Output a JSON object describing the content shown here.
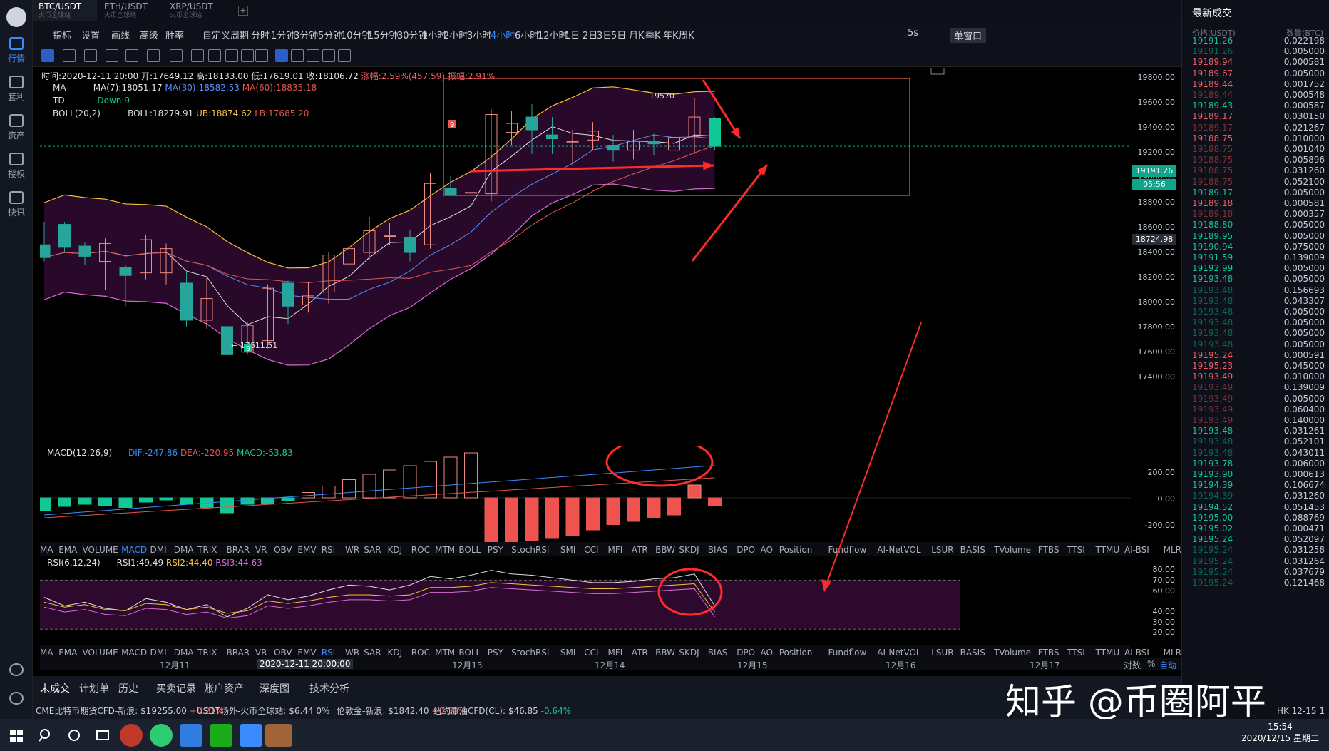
{
  "pair_tabs": [
    {
      "label": "BTC/USDT",
      "sub": "火币全球站"
    },
    {
      "label": "ETH/USDT",
      "sub": "火币全球站"
    },
    {
      "label": "XRP/USDT",
      "sub": "火币全球站"
    }
  ],
  "sidebar": [
    {
      "label": "行情"
    },
    {
      "label": "套利"
    },
    {
      "label": "资产"
    },
    {
      "label": "授权"
    },
    {
      "label": "快讯"
    }
  ],
  "toolbar": {
    "items": [
      "指标",
      "设置",
      "画线",
      "高级",
      "胜率",
      "自定义周期",
      "分时",
      "1分钟",
      "3分钟",
      "5分钟",
      "10分钟",
      "15分钟",
      "30分钟",
      "1小时",
      "2小时",
      "3小时",
      "4小时",
      "6小时",
      "12小时",
      "1日",
      "2日",
      "3日",
      "5日",
      "月K",
      "季K",
      "年K",
      "周K"
    ],
    "active": "4小时",
    "refresh": "5s",
    "window_label": "单窗口"
  },
  "info_line": {
    "time": "时间:2020-12-11 20:00",
    "open": "开:17649.12",
    "high": "高:18133.00",
    "low": "低:17619.01",
    "close": "收:18106.72",
    "change": "涨幅:2.59%(457.59)",
    "amp": "振幅:2.91%"
  },
  "ma_line": {
    "name": "MA",
    "ma7": "MA(7):18051.17",
    "ma30": "MA(30):18582.53",
    "ma60": "MA(60):18835.18"
  },
  "td_line": {
    "name": "TD",
    "down": "Down:9"
  },
  "boll_line": {
    "name": "BOLL(20,2)",
    "boll": "BOLL:18279.91",
    "ub": "UB:18874.62",
    "lb": "LB:17685.20"
  },
  "annotations": {
    "high": "19570",
    "low": "17611.51",
    "td_sell": "9",
    "td_buy": "9"
  },
  "price_axis": [
    "19800.00",
    "19600.00",
    "19400.00",
    "19200.00",
    "19000.00",
    "18800.00",
    "18600.00",
    "18400.00",
    "18200.00",
    "18000.00",
    "17800.00",
    "17600.00",
    "17400.00"
  ],
  "last_price": "19191.26",
  "countdown": "05:56",
  "crosshair_price": "18724.98",
  "macd": {
    "title": "MACD(12,26,9)",
    "dif": "DIF:-247.86",
    "dea": "DEA:-220.95",
    "macd": "MACD:-53.83",
    "axis": [
      "200.00",
      "0.00",
      "-200.00"
    ]
  },
  "rsi": {
    "title": "RSI(6,12,24)",
    "rsi1": "RSI1:49.49",
    "rsi2": "RSI2:44.40",
    "rsi3": "RSI3:44.63",
    "axis": [
      "80.00",
      "70.00",
      "60.00",
      "40.00",
      "30.00",
      "20.00"
    ]
  },
  "indicators": [
    "MA",
    "EMA",
    "VOLUME",
    "MACD",
    "DMI",
    "DMA",
    "TRIX",
    "BRAR",
    "VR",
    "OBV",
    "EMV",
    "RSI",
    "WR",
    "SAR",
    "KDJ",
    "ROC",
    "MTM",
    "BOLL",
    "PSY",
    "StochRSI",
    "SMI",
    "CCI",
    "MFI",
    "ATR",
    "BBW",
    "SKDJ",
    "BIAS",
    "DPO",
    "AO",
    "Position",
    "Fundflow",
    "AI-NetVOL",
    "LSUR",
    "BASIS",
    "TVolume",
    "FTBS",
    "TTSI",
    "TTMU",
    "AI-BSI",
    "MLR"
  ],
  "xaxis": {
    "labels": [
      "12月11",
      "2020-12-11 20:00:00",
      "12月13",
      "12月14",
      "12月15",
      "12月16",
      "12月17"
    ],
    "right": [
      "对数",
      "%",
      "自动"
    ]
  },
  "bottom_tabs": [
    "未成交",
    "计划单",
    "历史",
    "买卖记录",
    "账户资产",
    "深度图",
    "技术分析"
  ],
  "ticker": [
    {
      "name": "CME比特币期货CFD-新浪:",
      "price": "$19255.00",
      "chg": "+0.21%"
    },
    {
      "name": "USDT场外-火币全球站:",
      "price": "$6.44",
      "chg": "0%"
    },
    {
      "name": "伦敦金-新浪:",
      "price": "$1842.40",
      "chg": "+0.51%"
    },
    {
      "name": "纽约原油CFD(CL):",
      "price": "$46.85",
      "chg": "-0.64%"
    }
  ],
  "trades": {
    "title": "最新成交",
    "col_price": "价格(USDT)",
    "col_qty": "数量(BTC)",
    "rows": [
      [
        "19191.26",
        "0.022198",
        "g"
      ],
      [
        "19191.26",
        "0.005000",
        "gd"
      ],
      [
        "19189.94",
        "0.000581",
        "r"
      ],
      [
        "19189.67",
        "0.005000",
        "r"
      ],
      [
        "19189.44",
        "0.001752",
        "r"
      ],
      [
        "19189.44",
        "0.000548",
        "rd"
      ],
      [
        "19189.43",
        "0.000587",
        "g"
      ],
      [
        "19189.17",
        "0.030150",
        "r"
      ],
      [
        "19189.17",
        "0.021267",
        "rd"
      ],
      [
        "19188.75",
        "0.010000",
        "r"
      ],
      [
        "19188.75",
        "0.001040",
        "rd"
      ],
      [
        "19188.75",
        "0.005896",
        "rd"
      ],
      [
        "19188.75",
        "0.031260",
        "rd"
      ],
      [
        "19188.75",
        "0.052100",
        "rd"
      ],
      [
        "19189.17",
        "0.005000",
        "g"
      ],
      [
        "19189.18",
        "0.000581",
        "r"
      ],
      [
        "19189.18",
        "0.000357",
        "rd"
      ],
      [
        "19188.80",
        "0.005000",
        "g"
      ],
      [
        "19189.95",
        "0.005000",
        "g"
      ],
      [
        "19190.94",
        "0.075000",
        "g"
      ],
      [
        "19191.59",
        "0.139009",
        "g"
      ],
      [
        "19192.99",
        "0.005000",
        "g"
      ],
      [
        "19193.48",
        "0.005000",
        "g"
      ],
      [
        "19193.48",
        "0.156693",
        "gd"
      ],
      [
        "19193.48",
        "0.043307",
        "gd"
      ],
      [
        "19193.48",
        "0.005000",
        "gd"
      ],
      [
        "19193.48",
        "0.005000",
        "gd"
      ],
      [
        "19193.48",
        "0.005000",
        "gd"
      ],
      [
        "19193.48",
        "0.005000",
        "gd"
      ],
      [
        "19195.24",
        "0.000591",
        "r"
      ],
      [
        "19195.23",
        "0.045000",
        "r"
      ],
      [
        "19193.49",
        "0.010000",
        "r"
      ],
      [
        "19193.49",
        "0.139009",
        "rd"
      ],
      [
        "19193.49",
        "0.005000",
        "rd"
      ],
      [
        "19193.49",
        "0.060400",
        "rd"
      ],
      [
        "19193.49",
        "0.140000",
        "rd"
      ],
      [
        "19193.48",
        "0.031261",
        "g"
      ],
      [
        "19193.48",
        "0.052101",
        "gd"
      ],
      [
        "19193.48",
        "0.043011",
        "gd"
      ],
      [
        "19193.78",
        "0.006000",
        "g"
      ],
      [
        "19193.90",
        "0.000613",
        "g"
      ],
      [
        "19194.39",
        "0.106674",
        "g"
      ],
      [
        "19194.39",
        "0.031260",
        "gd"
      ],
      [
        "19194.52",
        "0.051453",
        "g"
      ],
      [
        "19195.00",
        "0.088769",
        "g"
      ],
      [
        "19195.02",
        "0.000471",
        "g"
      ],
      [
        "19195.24",
        "0.052097",
        "g"
      ],
      [
        "19195.24",
        "0.031258",
        "gd"
      ],
      [
        "19195.24",
        "0.031264",
        "gd"
      ],
      [
        "19195.24",
        "0.037679",
        "gd"
      ],
      [
        "19195.24",
        "0.121468",
        "gd"
      ]
    ]
  },
  "right_status": "HK 12-15 1",
  "taskbar": {
    "time": "15:54",
    "date": "2020/12/15 星期二"
  },
  "watermark": "知乎 @币圈阿平",
  "chart_data": {
    "type": "candlestick",
    "interval": "4小时",
    "x_labels": [
      "12月11",
      "12月13",
      "12月14",
      "12月15",
      "12月16",
      "12月17"
    ],
    "ylim": [
      17400,
      19800
    ],
    "candles": [
      [
        18420,
        18320,
        18600,
        18290
      ],
      [
        18580,
        18400,
        18600,
        18360
      ],
      [
        18410,
        18330,
        18440,
        18260
      ],
      [
        18290,
        18430,
        18470,
        18070
      ],
      [
        18240,
        18180,
        18260,
        17940
      ],
      [
        18200,
        18460,
        18500,
        18150
      ],
      [
        18200,
        18390,
        18430,
        18110
      ],
      [
        18120,
        17830,
        18210,
        17780
      ],
      [
        17830,
        18000,
        18160,
        17760
      ],
      [
        17780,
        17560,
        17810,
        17500
      ],
      [
        17580,
        17790,
        17820,
        17560
      ],
      [
        17670,
        18080,
        18110,
        17610
      ],
      [
        18120,
        17940,
        18140,
        17800
      ],
      [
        17950,
        18020,
        18130,
        17890
      ],
      [
        18050,
        18340,
        18360,
        17960
      ],
      [
        18270,
        18390,
        18440,
        18210
      ],
      [
        18360,
        18530,
        18640,
        18300
      ],
      [
        18490,
        18490,
        18590,
        18420
      ],
      [
        18480,
        18360,
        18540,
        18290
      ],
      [
        18420,
        18900,
        18980,
        18390
      ],
      [
        18860,
        18810,
        18960,
        18800
      ],
      [
        18830,
        18830,
        18870,
        18790
      ],
      [
        18820,
        19440,
        19480,
        18760
      ],
      [
        19300,
        19370,
        19470,
        19200
      ],
      [
        19420,
        19320,
        19520,
        19130
      ],
      [
        19280,
        19250,
        19420,
        19130
      ],
      [
        19230,
        19230,
        19320,
        19050
      ],
      [
        19240,
        19310,
        19380,
        19160
      ],
      [
        19200,
        19160,
        19280,
        19070
      ],
      [
        19160,
        19230,
        19320,
        19090
      ],
      [
        19230,
        19210,
        19290,
        19120
      ],
      [
        19160,
        19260,
        19350,
        19090
      ],
      [
        19270,
        19420,
        19570,
        19130
      ],
      [
        19410,
        19191,
        19420,
        19160
      ]
    ],
    "macd_hist": [
      -60,
      -40,
      -30,
      -35,
      -45,
      -20,
      -10,
      -30,
      -45,
      -70,
      -30,
      -25,
      -15,
      25,
      55,
      85,
      110,
      130,
      150,
      170,
      190,
      210,
      -235,
      -215,
      -200,
      -190,
      -175,
      -150,
      -125,
      -110,
      -95,
      -80,
      60,
      -35
    ],
    "rsi1": [
      56,
      49,
      52,
      47,
      45,
      55,
      52,
      46,
      50,
      40,
      47,
      58,
      54,
      57,
      62,
      66,
      65,
      62,
      66,
      73,
      71,
      74,
      78,
      75,
      74,
      72,
      70,
      68,
      68,
      69,
      71,
      72,
      75,
      49
    ],
    "rsi2": [
      52,
      48,
      50,
      46,
      45,
      51,
      50,
      46,
      48,
      43,
      45,
      53,
      51,
      53,
      56,
      58,
      58,
      57,
      58,
      64,
      64,
      65,
      68,
      67,
      66,
      65,
      64,
      63,
      63,
      64,
      65,
      66,
      67,
      44
    ]
  }
}
